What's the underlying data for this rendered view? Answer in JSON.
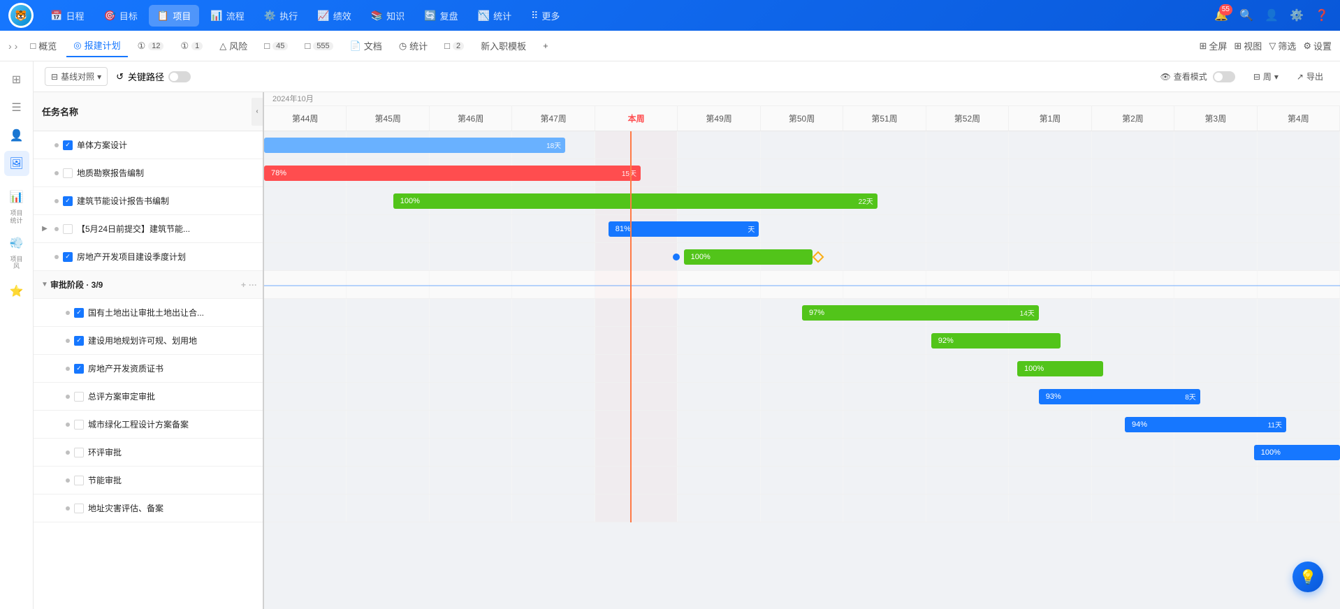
{
  "app": {
    "logo_text": "🐯",
    "notification_count": "55"
  },
  "top_nav": {
    "items": [
      {
        "label": "日程",
        "icon": "📅",
        "active": false
      },
      {
        "label": "目标",
        "icon": "🎯",
        "active": false
      },
      {
        "label": "项目",
        "icon": "📋",
        "active": true
      },
      {
        "label": "流程",
        "icon": "📊",
        "active": false
      },
      {
        "label": "执行",
        "icon": "⚙️",
        "active": false
      },
      {
        "label": "绩效",
        "icon": "📈",
        "active": false
      },
      {
        "label": "知识",
        "icon": "📚",
        "active": false
      },
      {
        "label": "复盘",
        "icon": "🔄",
        "active": false
      },
      {
        "label": "统计",
        "icon": "📉",
        "active": false
      },
      {
        "label": "更多",
        "icon": "···",
        "active": false
      }
    ]
  },
  "second_bar": {
    "tabs": [
      {
        "label": "概览",
        "icon": "□",
        "count": null,
        "active": false
      },
      {
        "label": "报建计划",
        "icon": "◎",
        "count": null,
        "active": true
      },
      {
        "label": "",
        "icon": "①",
        "count": "12",
        "active": false
      },
      {
        "label": "",
        "icon": "①",
        "count": "1",
        "active": false
      },
      {
        "label": "风险",
        "icon": "△",
        "count": null,
        "active": false
      },
      {
        "label": "",
        "icon": "□",
        "count": "45",
        "active": false
      },
      {
        "label": "",
        "icon": "□",
        "count": "555",
        "active": false
      },
      {
        "label": "文档",
        "icon": "📄",
        "count": null,
        "active": false
      },
      {
        "label": "统计",
        "icon": "◷",
        "count": null,
        "active": false
      },
      {
        "label": "",
        "icon": "□",
        "count": "2",
        "active": false
      },
      {
        "label": "新入职模板",
        "icon": "",
        "count": null,
        "active": false
      },
      {
        "label": "+",
        "icon": "",
        "count": null,
        "active": false
      }
    ],
    "right": {
      "fullscreen": "全屏",
      "view": "视图",
      "filter": "筛选",
      "settings": "设置"
    }
  },
  "toolbar": {
    "baseline": "基线对照",
    "critical_path": "关键路径",
    "view_mode": "查看模式",
    "week": "周",
    "export": "导出"
  },
  "task_list": {
    "header": "任务名称",
    "tasks": [
      {
        "id": 1,
        "name": "单体方案设计",
        "checked": true,
        "indent": 1,
        "expand": false
      },
      {
        "id": 2,
        "name": "地质勘察报告编制",
        "checked": false,
        "indent": 1,
        "expand": false
      },
      {
        "id": 3,
        "name": "建筑节能设计报告书编制",
        "checked": true,
        "indent": 1,
        "expand": false
      },
      {
        "id": 4,
        "name": "【5月24日前提交】建筑节能...",
        "checked": false,
        "indent": 1,
        "expand": true
      },
      {
        "id": 5,
        "name": "房地产开发项目建设季度计划",
        "checked": true,
        "indent": 1,
        "expand": false
      },
      {
        "id": 6,
        "name": "审批阶段 · 3/9",
        "is_phase": true,
        "indent": 0,
        "expand": true
      },
      {
        "id": 7,
        "name": "国有土地出让审批土地出让合...",
        "checked": true,
        "indent": 2,
        "expand": false
      },
      {
        "id": 8,
        "name": "建设用地规划许可规、划用地",
        "checked": true,
        "indent": 2,
        "expand": false
      },
      {
        "id": 9,
        "name": "房地产开发资质证书",
        "checked": true,
        "indent": 2,
        "expand": false
      },
      {
        "id": 10,
        "name": "总评方案审定审批",
        "checked": false,
        "indent": 2,
        "expand": false
      },
      {
        "id": 11,
        "name": "城市绿化工程设计方案备案",
        "checked": false,
        "indent": 2,
        "expand": false
      },
      {
        "id": 12,
        "name": "环评审批",
        "checked": false,
        "indent": 2,
        "expand": false
      },
      {
        "id": 13,
        "name": "节能审批",
        "checked": false,
        "indent": 2,
        "expand": false
      },
      {
        "id": 14,
        "name": "地址灾害评估、备案",
        "checked": false,
        "indent": 2,
        "expand": false
      }
    ]
  },
  "gantt": {
    "month_label": "2024年10月",
    "weeks": [
      {
        "label": "第44周",
        "current": false
      },
      {
        "label": "第45周",
        "current": false
      },
      {
        "label": "第46周",
        "current": false
      },
      {
        "label": "第47周",
        "current": false
      },
      {
        "label": "本周",
        "current": true
      },
      {
        "label": "第49周",
        "current": false
      },
      {
        "label": "第50周",
        "current": false
      },
      {
        "label": "第51周",
        "current": false
      },
      {
        "label": "第52周",
        "current": false
      },
      {
        "label": "第1周",
        "current": false
      },
      {
        "label": "第2周",
        "current": false
      },
      {
        "label": "第3周",
        "current": false
      },
      {
        "label": "第4周",
        "current": false
      }
    ],
    "bars": [
      {
        "row": 0,
        "left_pct": 0,
        "width_pct": 28,
        "color": "light-blue",
        "label": "",
        "days": "18天"
      },
      {
        "row": 1,
        "left_pct": 0,
        "width_pct": 35,
        "color": "red",
        "label": "78%",
        "days": "15天"
      },
      {
        "row": 2,
        "left_pct": 12,
        "width_pct": 45,
        "color": "green",
        "label": "100%",
        "days": "22天"
      },
      {
        "row": 3,
        "left_pct": 32,
        "width_pct": 14,
        "color": "blue",
        "label": "81%",
        "days": "天"
      },
      {
        "row": 4,
        "left_pct": 39,
        "width_pct": 12,
        "color": "green",
        "label": "100%",
        "days": ""
      },
      {
        "row": 6,
        "left_pct": 50,
        "width_pct": 22,
        "color": "green",
        "label": "97%",
        "days": "14天"
      },
      {
        "row": 7,
        "left_pct": 62,
        "width_pct": 12,
        "color": "green",
        "label": "92%",
        "days": ""
      },
      {
        "row": 8,
        "left_pct": 70,
        "width_pct": 8,
        "color": "green",
        "label": "100%",
        "days": ""
      },
      {
        "row": 9,
        "left_pct": 72,
        "width_pct": 15,
        "color": "blue",
        "label": "93%",
        "days": "8天"
      },
      {
        "row": 10,
        "left_pct": 80,
        "width_pct": 15,
        "color": "blue",
        "label": "94%",
        "days": "11天"
      },
      {
        "row": 11,
        "left_pct": 92,
        "width_pct": 8,
        "color": "blue",
        "label": "100%",
        "days": ""
      }
    ],
    "today_position_pct": 34
  },
  "sidebar_icons": [
    {
      "icon": "⊞",
      "label": "",
      "active": false
    },
    {
      "icon": "☰",
      "label": "",
      "active": false
    },
    {
      "icon": "👤",
      "label": "",
      "active": false
    },
    {
      "icon": "🖼",
      "label": "",
      "active": true
    },
    {
      "icon": "📊",
      "label": "项目统计",
      "active": false
    },
    {
      "icon": "💨",
      "label": "项目风",
      "active": false
    },
    {
      "icon": "⭐",
      "label": "",
      "active": false
    }
  ],
  "float_btn": {
    "icon": "💡"
  }
}
